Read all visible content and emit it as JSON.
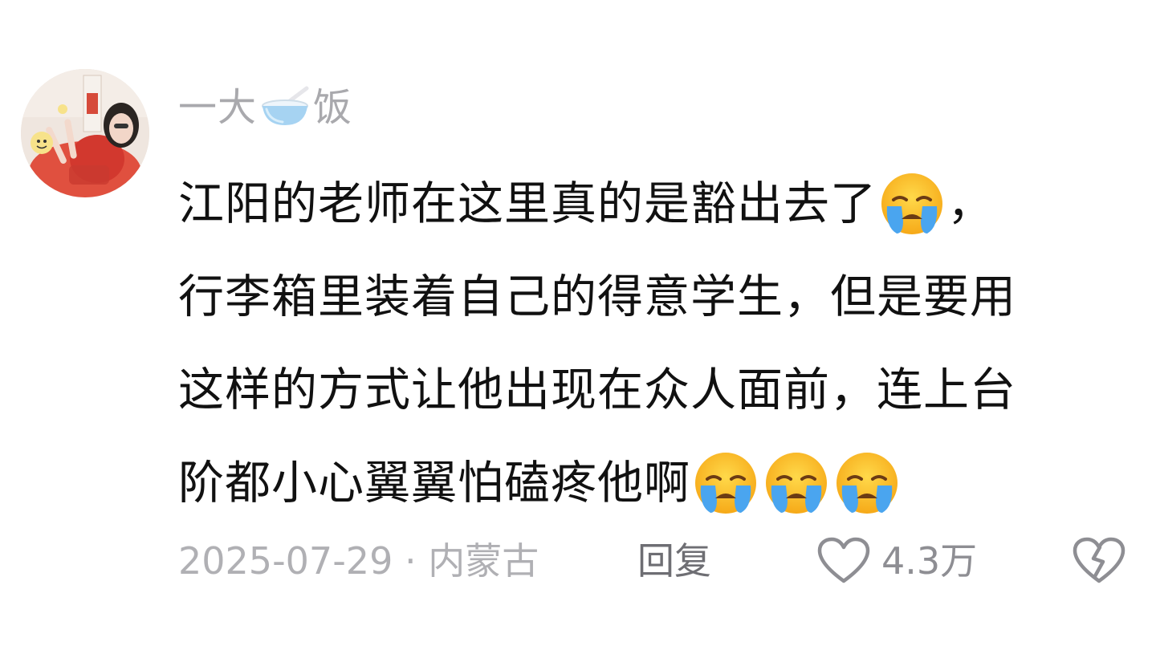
{
  "comment": {
    "user": {
      "name_before_icon": "一大",
      "name_icon": "bowl-icon",
      "name_after_icon": "饭"
    },
    "lines": [
      "江阳的老师在这里真的是豁出去了",
      "，",
      "行李箱里装着自己的得意学生，但是要用",
      "这样的方式让他出现在众人面前，连上台",
      "阶都小心翼翼怕磕疼他啊"
    ],
    "emojis": [
      "loudly-crying-face-icon",
      "loudly-crying-face-icon",
      "loudly-crying-face-icon",
      "loudly-crying-face-icon"
    ],
    "meta": {
      "date": "2025-07-29",
      "separator": "·",
      "location": "内蒙古"
    },
    "actions": {
      "reply_label": "回复",
      "like_count": "4.3万"
    }
  },
  "colors": {
    "username": "#a9a9ad",
    "body_text": "#111111",
    "meta_text": "#b0b0b4",
    "reply_text": "#6e6e73",
    "icon_stroke": "#8e8e93",
    "background": "#ffffff"
  }
}
